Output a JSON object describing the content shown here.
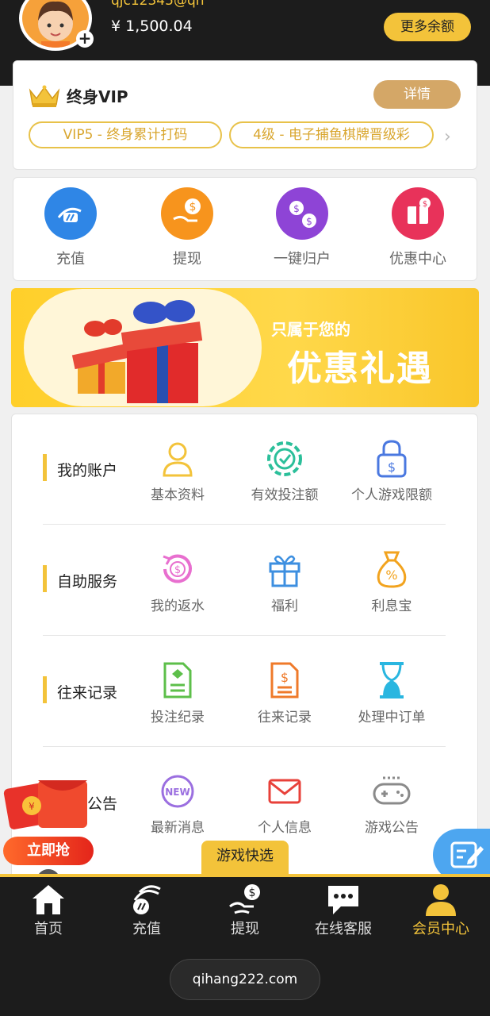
{
  "header": {
    "username": "qjc12345@qh",
    "balance": "¥ 1,500.04",
    "more_balance_label": "更多余额"
  },
  "vip": {
    "title": "终身VIP",
    "detail_label": "详情",
    "chips": [
      "VIP5 - 终身累计打码",
      "4级 - 电子捕鱼棋牌晋级彩"
    ]
  },
  "quick_actions": [
    {
      "label": "充值",
      "icon": "deposit-icon",
      "color": "#2f86e6"
    },
    {
      "label": "提现",
      "icon": "withdraw-icon",
      "color": "#f7941d"
    },
    {
      "label": "一键归户",
      "icon": "transfer-icon",
      "color": "#8e44d6"
    },
    {
      "label": "优惠中心",
      "icon": "promo-icon",
      "color": "#e8325a"
    }
  ],
  "banner": {
    "subtitle": "只属于您的",
    "title": "优惠礼遇"
  },
  "sections": [
    {
      "title": "我的账户",
      "items": [
        {
          "label": "基本资料",
          "icon": "user-icon"
        },
        {
          "label": "有效投注额",
          "icon": "chip-icon"
        },
        {
          "label": "个人游戏限额",
          "icon": "lock-dollar-icon"
        }
      ]
    },
    {
      "title": "自助服务",
      "items": [
        {
          "label": "我的返水",
          "icon": "rebate-icon"
        },
        {
          "label": "福利",
          "icon": "gift-icon"
        },
        {
          "label": "利息宝",
          "icon": "money-bag-icon"
        }
      ]
    },
    {
      "title": "往来记录",
      "items": [
        {
          "label": "投注纪录",
          "icon": "bet-record-icon"
        },
        {
          "label": "往来记录",
          "icon": "transaction-record-icon"
        },
        {
          "label": "处理中订单",
          "icon": "hourglass-icon"
        }
      ]
    },
    {
      "title": "消息公告",
      "items": [
        {
          "label": "最新消息",
          "icon": "new-badge-icon"
        },
        {
          "label": "个人信息",
          "icon": "mail-icon"
        },
        {
          "label": "游戏公告",
          "icon": "gamepad-icon"
        }
      ]
    }
  ],
  "floating": {
    "grab_label": "立即抢",
    "close_label": "✕",
    "game_quick_label": "游戏快选"
  },
  "tabbar": [
    {
      "label": "首页",
      "icon": "home-icon"
    },
    {
      "label": "充值",
      "icon": "deposit-icon"
    },
    {
      "label": "提现",
      "icon": "withdraw-icon"
    },
    {
      "label": "在线客服",
      "icon": "chat-icon"
    },
    {
      "label": "会员中心",
      "icon": "member-icon",
      "active": true
    }
  ],
  "url": "qihang222.com",
  "colors": {
    "accent": "#f3c33a",
    "dark": "#1c1c1c",
    "gold": "#d4a767"
  }
}
